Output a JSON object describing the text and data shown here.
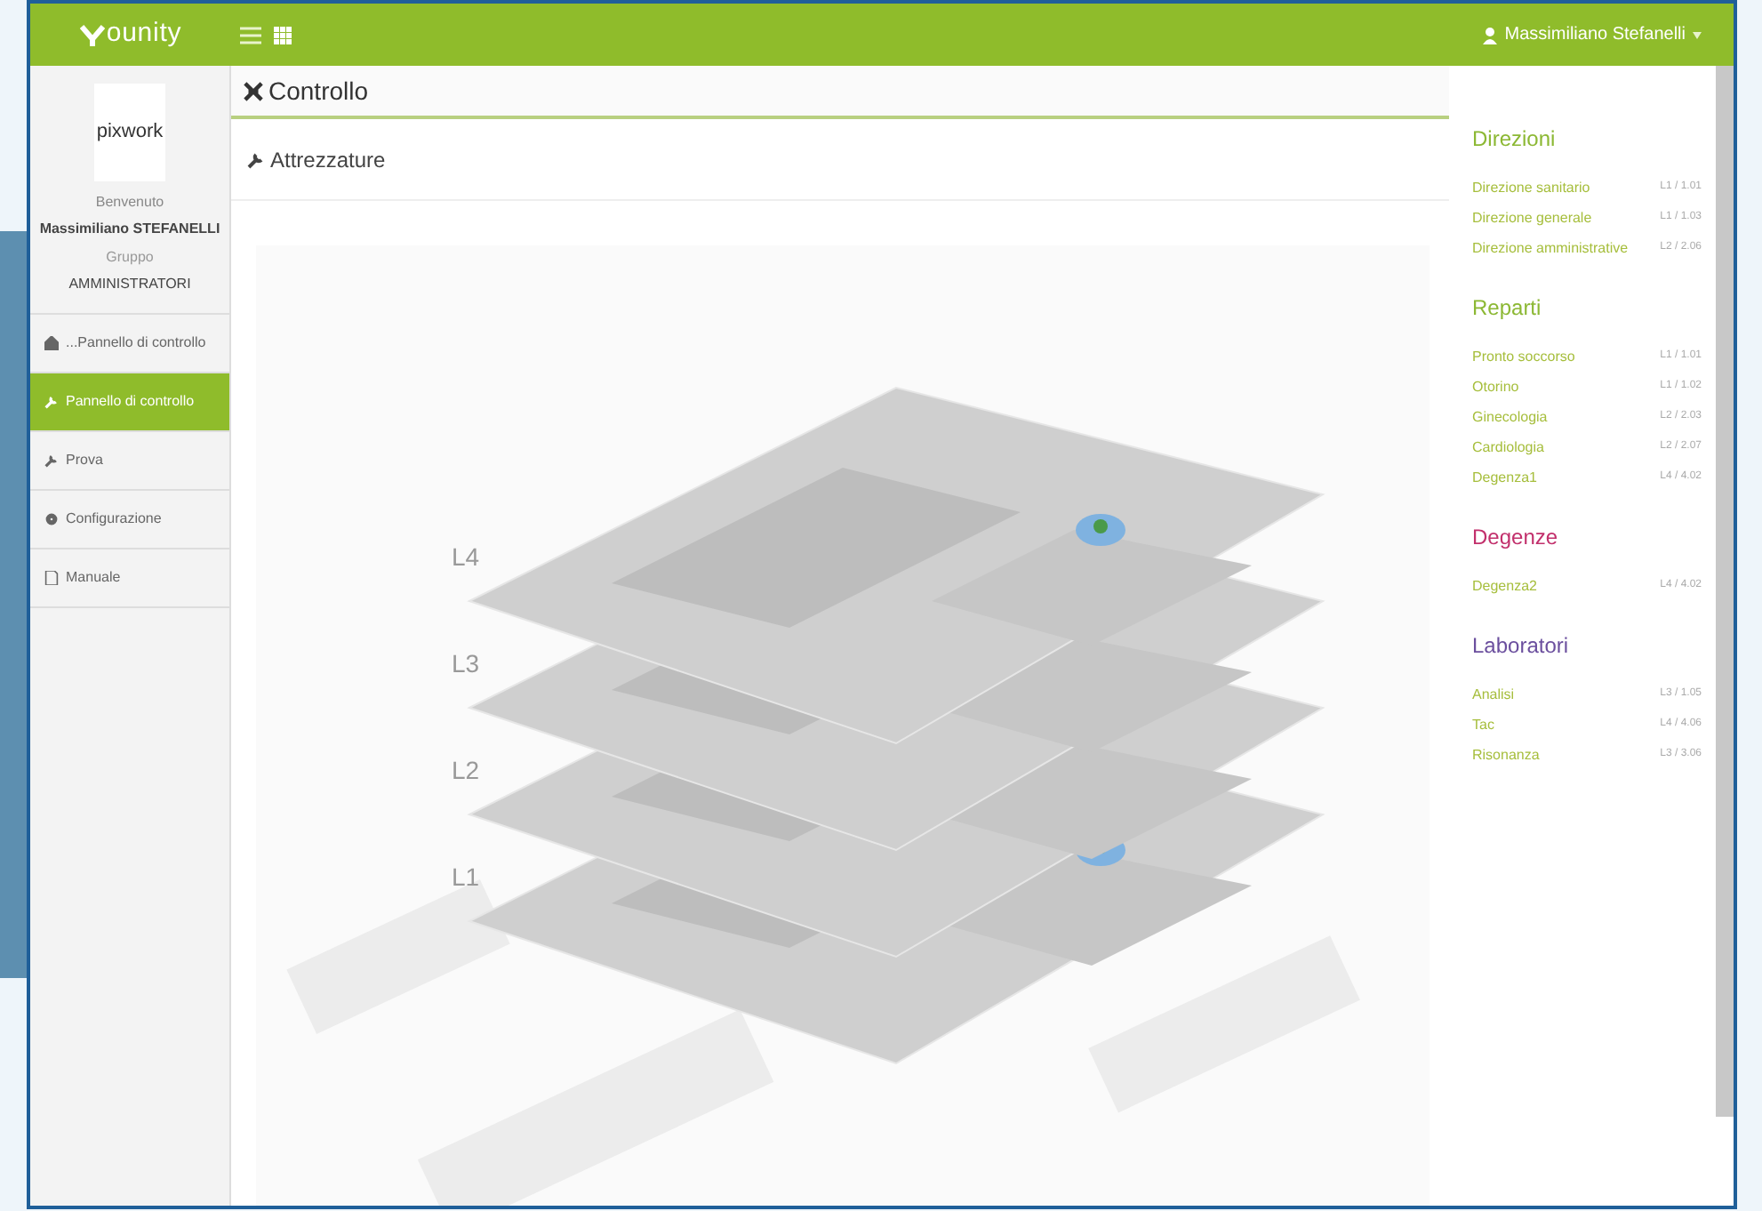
{
  "topbar": {
    "logo": "ounity",
    "user": "Massimiliano Stefanelli"
  },
  "sidebar": {
    "brand": "pixwork",
    "welcome": "Benvenuto",
    "user": "Massimiliano STEFANELLI",
    "group_label": "Gruppo",
    "group": "AMMINISTRATORI",
    "items": [
      {
        "label": "...Pannello di controllo",
        "kind": "home",
        "selected": false
      },
      {
        "label": "Pannello di controllo",
        "kind": "wrench",
        "selected": true
      },
      {
        "label": "Prova",
        "kind": "wrench",
        "selected": false
      },
      {
        "label": "Configurazione",
        "kind": "gear",
        "selected": false
      },
      {
        "label": "Manuale",
        "kind": "document",
        "selected": false
      }
    ]
  },
  "main": {
    "title": "Controllo",
    "subtitle": "Attrezzature",
    "floors": [
      "L4",
      "L3",
      "L2",
      "L1"
    ]
  },
  "legend": [
    {
      "title": "Direzioni",
      "color": "#8cb834",
      "items": [
        {
          "name": "Direzione sanitario",
          "code": "L1 / 1.01"
        },
        {
          "name": "Direzione generale",
          "code": "L1 / 1.03"
        },
        {
          "name": "Direzione amministrative",
          "code": "L2 / 2.06"
        }
      ]
    },
    {
      "title": "Reparti",
      "color": "#8cb834",
      "items": [
        {
          "name": "Pronto soccorso",
          "code": "L1 / 1.01"
        },
        {
          "name": "Otorino",
          "code": "L1 / 1.02"
        },
        {
          "name": "Ginecologia",
          "code": "L2 / 2.03"
        },
        {
          "name": "Cardiologia",
          "code": "L2 / 2.07"
        },
        {
          "name": "Degenza1",
          "code": "L4 / 4.02"
        }
      ]
    },
    {
      "title": "Degenze",
      "color": "#c2306c",
      "items": [
        {
          "name": "Degenza2",
          "code": "L4 / 4.02"
        }
      ]
    },
    {
      "title": "Laboratori",
      "color": "#6b4f9e",
      "items": [
        {
          "name": "Analisi",
          "code": "L3 / 1.05"
        },
        {
          "name": "Tac",
          "code": "L4 / 4.06"
        },
        {
          "name": "Risonanza",
          "code": "L3 / 3.06"
        }
      ]
    }
  ]
}
